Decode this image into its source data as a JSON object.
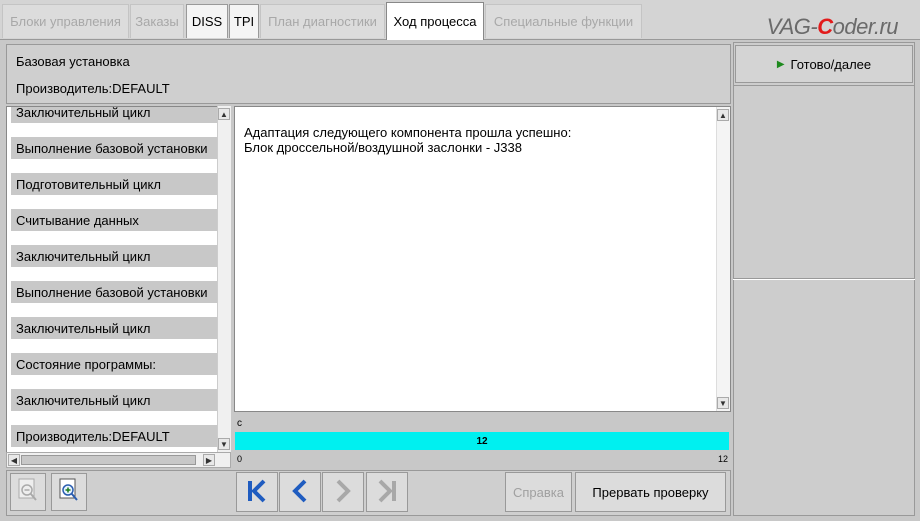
{
  "tabs": [
    {
      "label": "Блоки управления",
      "state": "disabled"
    },
    {
      "label": "Заказы",
      "state": "disabled"
    },
    {
      "label": "DISS",
      "state": "enabled"
    },
    {
      "label": "TPI",
      "state": "enabled"
    },
    {
      "label": "План диагностики",
      "state": "disabled"
    },
    {
      "label": "Ход процесса",
      "state": "active"
    },
    {
      "label": "Специальные функции",
      "state": "disabled"
    }
  ],
  "watermark": {
    "prefix": "VAG-",
    "c": "C",
    "suffix": "oder.ru"
  },
  "info": {
    "line1": "Базовая установка",
    "line2": "Производитель:DEFAULT"
  },
  "steps": [
    "Заключительный цикл",
    "Выполнение базовой установки",
    "Подготовительный цикл",
    "Считывание данных",
    "Заключительный цикл",
    "Выполнение базовой установки",
    "Заключительный цикл",
    "Состояние программы:",
    "Заключительный цикл",
    "Производитель:DEFAULT"
  ],
  "message": {
    "line1": "Адаптация следующего компонента прошла успешно:",
    "line2": "Блок дроссельной/воздушной заслонки - J338"
  },
  "progress": {
    "label": "с",
    "value": "12",
    "min": "0",
    "max": "12",
    "fraction": 1.0,
    "color": "#00f0f0"
  },
  "buttons": {
    "next": "Готово/далее",
    "help": "Справка",
    "abort": "Прервать проверку"
  },
  "icons": {
    "zoom_out": "zoom-out-icon",
    "zoom_in": "zoom-in-icon",
    "first": "skip-first-icon",
    "prev": "prev-icon",
    "next": "next-icon",
    "last": "skip-last-icon"
  }
}
